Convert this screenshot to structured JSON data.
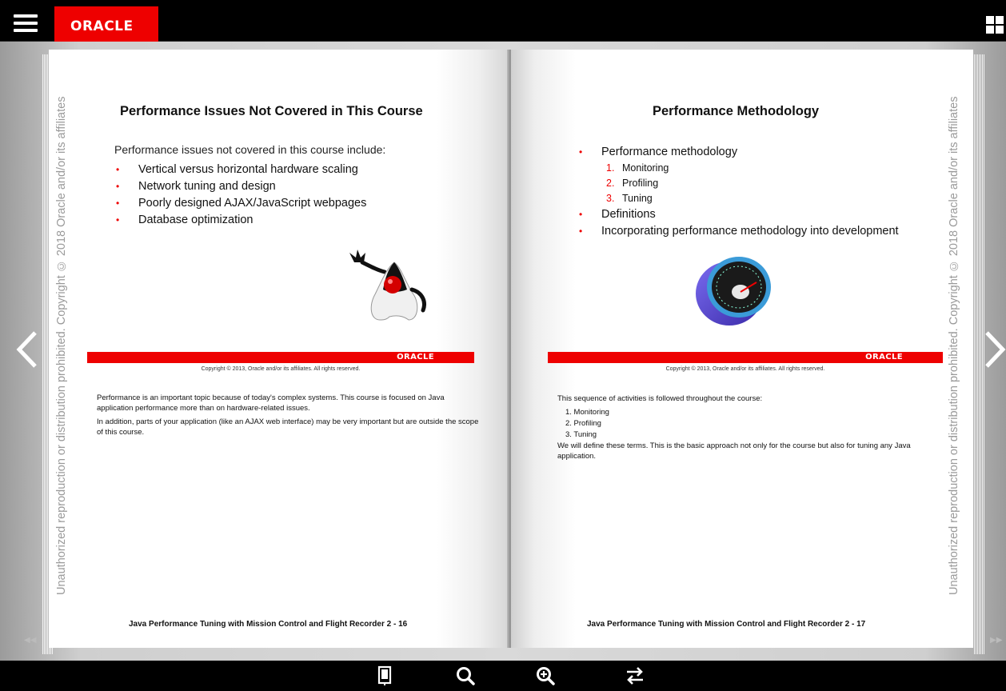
{
  "app": {
    "logo_text": "ORACLE",
    "brand_color": "#ee0000"
  },
  "toolbar_top": {
    "menu_icon": "hamburger-menu-icon",
    "grid_icon": "grid-view-icon"
  },
  "left_page": {
    "watermark": "Unauthorized reproduction or distribution prohibited. Copyright © 2018 Oracle and/or its affiliates",
    "slide_title": "Performance Issues Not Covered in This Course",
    "intro": "Performance issues not covered in this course include:",
    "bullets": [
      "Vertical versus horizontal hardware scaling",
      "Network tuning and design",
      "Poorly designed AJAX/JavaScript webpages",
      "Database optimization"
    ],
    "band_logo": "ORACLE",
    "copyright": "Copyright © 2013, Oracle and/or its affiliates. All rights reserved.",
    "notes": [
      "Performance is an important topic because of today's complex systems. This course is focused on Java application performance more than on hardware-related issues.",
      "In addition, parts of your application (like an AJAX web interface) may be very important but are outside the scope of this course."
    ],
    "footer": "Java Performance Tuning with Mission Control and Flight Recorder  2 - 16"
  },
  "right_page": {
    "watermark": "Unauthorized reproduction or distribution prohibited. Copyright © 2018 Oracle and/or its affiliates",
    "slide_title": "Performance Methodology",
    "bullet_1": "Performance methodology",
    "sub_items": [
      {
        "num": "1.",
        "text": "Monitoring"
      },
      {
        "num": "2.",
        "text": "Profiling"
      },
      {
        "num": "3.",
        "text": "Tuning"
      }
    ],
    "bullet_2": "Definitions",
    "bullet_3": "Incorporating performance methodology into development",
    "band_logo": "ORACLE",
    "copyright": "Copyright © 2013, Oracle and/or its affiliates. All rights reserved.",
    "notes_intro": "This sequence of activities is followed throughout the course:",
    "notes_list": [
      "1.  Monitoring",
      "2.  Profiling",
      "3.  Tuning"
    ],
    "notes_outro": "We will define these terms. This is the basic approach not only for the course but also for tuning any Java application.",
    "footer": "Java Performance Tuning with Mission Control and Flight Recorder  2 - 17"
  },
  "navigation": {
    "prev_icon": "chevron-left-icon",
    "next_icon": "chevron-right-icon",
    "skip_first": "◀◀",
    "skip_last": "▶▶"
  },
  "toolbar_bottom": {
    "items": [
      "table-of-contents-icon",
      "search-icon",
      "zoom-in-icon",
      "swap-view-icon"
    ]
  }
}
